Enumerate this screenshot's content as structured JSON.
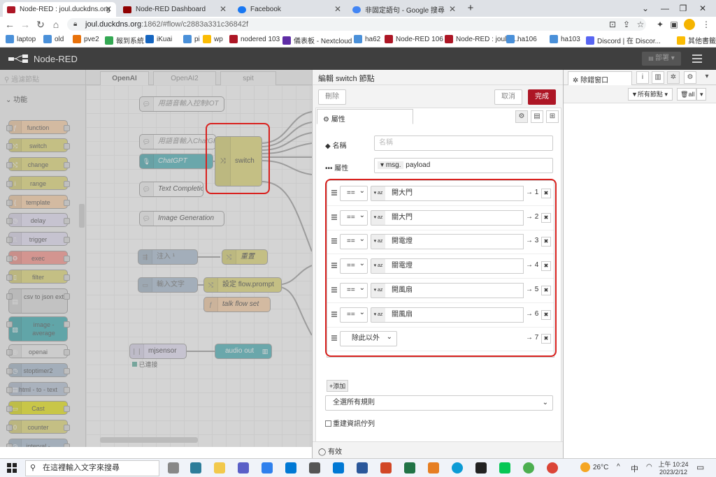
{
  "browser": {
    "tabs": [
      {
        "label": "Node-RED : joul.duckdns.org",
        "active": true,
        "color": "#ad1625"
      },
      {
        "label": "Node-RED Dashboard",
        "active": false,
        "color": "#8f0000"
      },
      {
        "label": "Facebook",
        "active": false,
        "color": "#1877f2"
      },
      {
        "label": "非固定語句 - Google 搜尋",
        "active": false,
        "color": "#4285f4"
      }
    ],
    "url_host": "joul.duckdns.org",
    "url_rest": ":1862/#flow/c2883a331c36842f",
    "bookmarks": [
      {
        "label": "laptop",
        "color": "#4a90d9"
      },
      {
        "label": "old",
        "color": "#4a90d9"
      },
      {
        "label": "pve2",
        "color": "#e8710a"
      },
      {
        "label": "報到系統",
        "color": "#34a853"
      },
      {
        "label": "iKuai",
        "color": "#1565c0"
      },
      {
        "label": "pi",
        "color": "#4a90d9"
      },
      {
        "label": "wp",
        "color": "#fbbc04"
      },
      {
        "label": "nodered 103",
        "color": "#ad1625"
      },
      {
        "label": "儀表板 - Nextcloud",
        "color": "#5e2ca5"
      },
      {
        "label": "ha62",
        "color": "#4a90d9"
      },
      {
        "label": "Node-RED 106",
        "color": "#ad1625"
      },
      {
        "label": "Node-RED : joul.d...",
        "color": "#ad1625"
      },
      {
        "label": "ha106",
        "color": "#4a90d9"
      },
      {
        "label": "ha103",
        "color": "#4a90d9"
      },
      {
        "label": "Discord | 在 Discor...",
        "color": "#5865f2"
      },
      {
        "label": "其他書籤",
        "color": "#fbbc04"
      }
    ]
  },
  "nodered": {
    "title": "Node-RED",
    "deploy_label": "部署",
    "palette": {
      "search_placeholder": "過濾節點",
      "category": "功能",
      "nodes": [
        {
          "label": "function",
          "color": "#fdd0a2",
          "icon": "ƒ"
        },
        {
          "label": "switch",
          "color": "#e2d96e",
          "icon": "⤨"
        },
        {
          "label": "change",
          "color": "#e2d96e",
          "icon": "⤭"
        },
        {
          "label": "range",
          "color": "#e2d96e",
          "icon": "i"
        },
        {
          "label": "template",
          "color": "#fdd0a2",
          "icon": "{"
        },
        {
          "label": "delay",
          "color": "#e6e0f8",
          "icon": "◷"
        },
        {
          "label": "trigger",
          "color": "#e6e0f8",
          "icon": "⎍"
        },
        {
          "label": "exec",
          "color": "#fd8c83",
          "icon": "⚙"
        },
        {
          "label": "filter",
          "color": "#e2d96e",
          "icon": "▯"
        },
        {
          "label": "csv to json ext",
          "color": "#dedede",
          "icon": "▤"
        },
        {
          "label": "image - average",
          "color": "#2fa9b0",
          "icon": "▨"
        },
        {
          "label": "openai",
          "color": "#f0f0f0",
          "icon": "◎"
        },
        {
          "label": "stoptimer2",
          "color": "#a6bbcf",
          "icon": "◷"
        },
        {
          "label": "html - to - text",
          "color": "#b3c1d6",
          "icon": "▤"
        },
        {
          "label": "Cast",
          "color": "#e9e600",
          "icon": "▭"
        },
        {
          "label": "counter",
          "color": "#e2d96e",
          "icon": "0"
        },
        {
          "label": "interval -",
          "color": "#a6bbcf",
          "icon": "◷"
        }
      ]
    },
    "workspace": {
      "tabs": [
        "OpenAI",
        "OpenAI2",
        "spit"
      ],
      "nodes": [
        {
          "label": "用語音輸入控制IOT",
          "color": "#ffffff"
        },
        {
          "label": "用語音輸入ChatGPT",
          "color": "#ffffff"
        },
        {
          "label": "ChatGPT",
          "color": "#3fadb5"
        },
        {
          "label": "Text Completion",
          "color": "#ffffff"
        },
        {
          "label": "Image Generation",
          "color": "#ffffff"
        },
        {
          "label": "注入 ¹",
          "color": "#a6bbcf"
        },
        {
          "label": "重置",
          "color": "#e2d96e"
        },
        {
          "label": "輸入文字",
          "color": "#a6bbcf"
        },
        {
          "label": "設定 flow.prompt",
          "color": "#e2d96e"
        },
        {
          "label": "talk flow set",
          "color": "#fdd0a2"
        },
        {
          "label": "mjsensor",
          "color": "#e6e0f8"
        },
        {
          "label": "audio out",
          "color": "#3fadb5"
        },
        {
          "label": "switch",
          "color": "#e2d96e"
        }
      ],
      "status_connected": "已連接"
    },
    "editor": {
      "title": "編輯 switch 節點",
      "delete_label": "刪除",
      "cancel_label": "取消",
      "done_label": "完成",
      "properties_tab": "屬性",
      "name_label": "名稱",
      "name_placeholder": "名稱",
      "property_label": "屬性",
      "property_prefix": "msg.",
      "property_value": "payload",
      "rules": [
        {
          "op": "==",
          "type": "az",
          "value": "開大門",
          "output": "→ 1"
        },
        {
          "op": "==",
          "type": "az",
          "value": "關大門",
          "output": "→ 2"
        },
        {
          "op": "==",
          "type": "az",
          "value": "開電燈",
          "output": "→ 3"
        },
        {
          "op": "==",
          "type": "az",
          "value": "關電燈",
          "output": "→ 4"
        },
        {
          "op": "==",
          "type": "az",
          "value": "開風扇",
          "output": "→ 5"
        },
        {
          "op": "==",
          "type": "az",
          "value": "關風扇",
          "output": "→ 6"
        }
      ],
      "otherwise_rule": {
        "label": "除此以外",
        "output": "→ 7"
      },
      "add_label": "+添加",
      "check_all_label": "全選所有規則",
      "recreate_label": "重建資訊佇列",
      "enabled_label": "有效"
    },
    "sidebar": {
      "tab_label": "除錯窗口",
      "filter_label": "所有節點",
      "all_label": "all"
    }
  },
  "taskbar": {
    "search_placeholder": "在這裡輸入文字來搜尋",
    "temperature": "26°C",
    "ime": "中",
    "time": "上午 10:24",
    "date": "2023/2/12"
  }
}
